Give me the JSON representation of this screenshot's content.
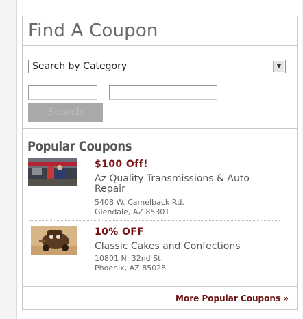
{
  "widget": {
    "title": "Find A Coupon",
    "category_select": {
      "selected": "Search by Category"
    },
    "inputs": [
      {
        "value": ""
      },
      {
        "value": ""
      }
    ],
    "search_label": "Search"
  },
  "popular": {
    "heading": "Popular Coupons",
    "coupons": [
      {
        "deal": "$100 Off!",
        "business": "Az Quality Transmissions & Auto Repair",
        "address_line1": "5408 W. Camelback Rd.",
        "address_line2": "Glendale, AZ 85301"
      },
      {
        "deal": "10% OFF",
        "business": "Classic Cakes and Confections",
        "address_line1": "10801 N. 32nd St.",
        "address_line2": "Phoenix, AZ 85028"
      }
    ],
    "more_link": "More Popular Coupons »"
  },
  "colors": {
    "deal_red": "#7a1414",
    "link_red": "#6b1212",
    "button_gray": "#a9a9a9"
  }
}
